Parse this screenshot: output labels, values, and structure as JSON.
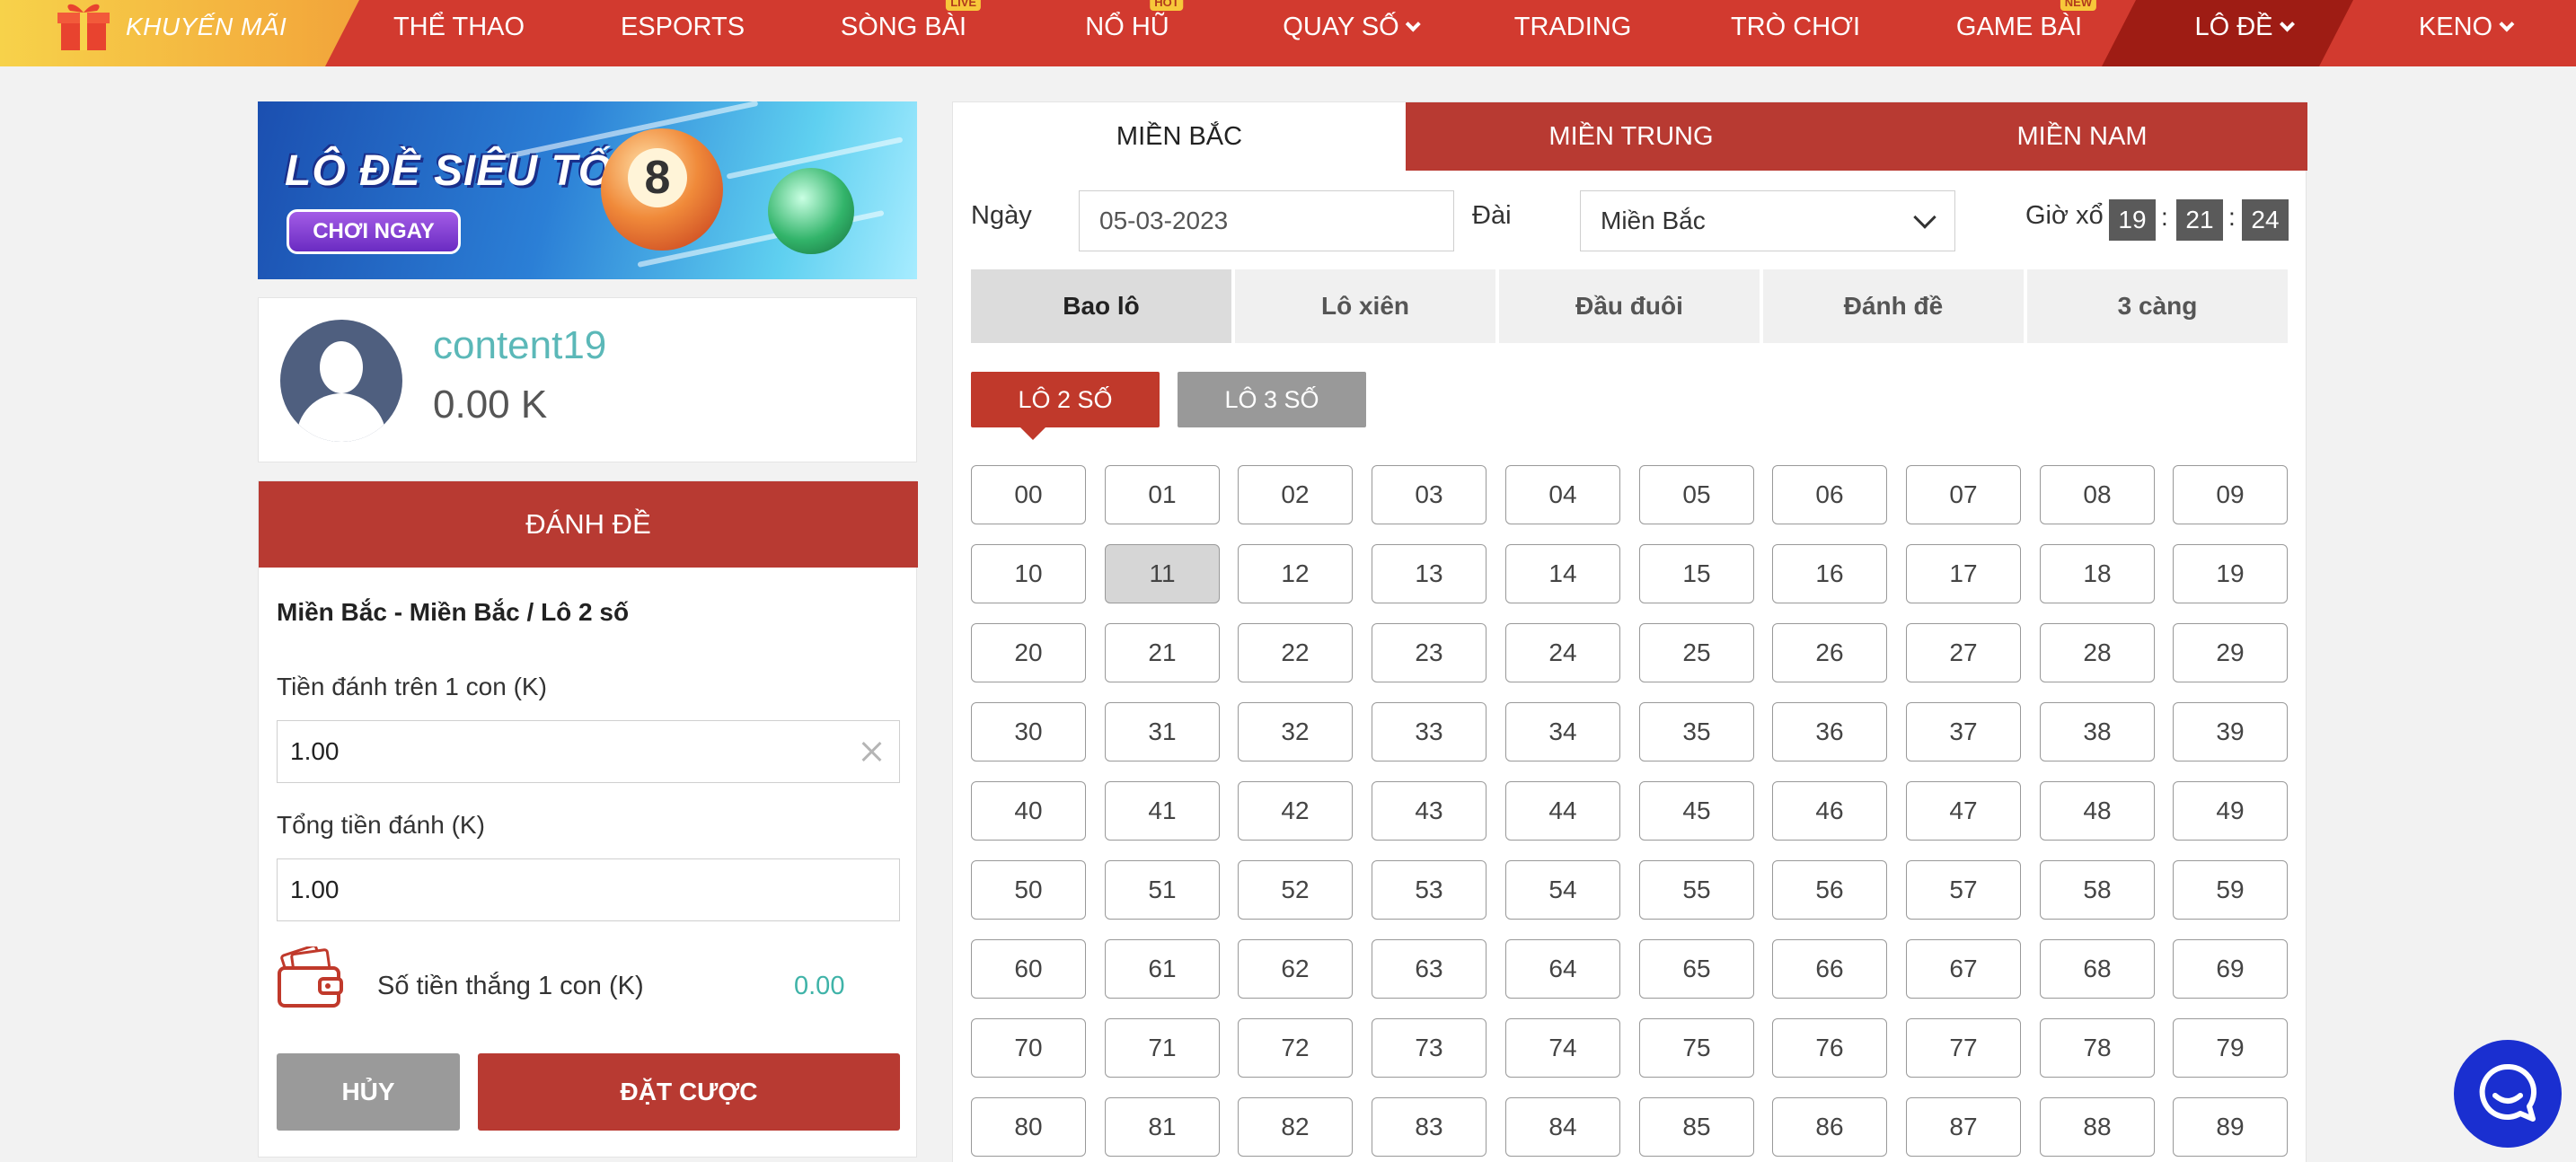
{
  "nav": {
    "promo_label": "KHUYẾN MÃI",
    "items": [
      {
        "label": "THỂ THAO",
        "badge": ""
      },
      {
        "label": "ESPORTS",
        "badge": ""
      },
      {
        "label": "SÒNG BÀI",
        "badge": "LIVE"
      },
      {
        "label": "NỔ HŨ",
        "badge": "HOT"
      },
      {
        "label": "QUAY SỐ",
        "badge": ""
      },
      {
        "label": "TRADING",
        "badge": ""
      },
      {
        "label": "TRÒ CHƠI",
        "badge": ""
      },
      {
        "label": "GAME BÀI",
        "badge": "NEW"
      },
      {
        "label": "LÔ ĐỀ",
        "badge": ""
      },
      {
        "label": "KENO",
        "badge": ""
      }
    ]
  },
  "banner": {
    "title": "LÔ ĐỀ SIÊU TỐC",
    "button": "CHƠI NGAY",
    "ball_number": "8"
  },
  "user": {
    "name": "content19",
    "balance": "0.00 K"
  },
  "bet_panel": {
    "header": "ĐÁNH ĐỀ",
    "subtitle": "Miền Bắc - Miền Bắc / Lô 2 số",
    "amount_label": "Tiền đánh trên 1 con (K)",
    "amount_value": "1.00",
    "total_label": "Tổng tiền đánh (K)",
    "total_value": "1.00",
    "win_label": "Số tiền thắng 1 con (K)",
    "win_value": "0.00",
    "cancel": "HỦY",
    "place_bet": "ĐẶT CƯỢC"
  },
  "regions": [
    "MIỀN BẮC",
    "MIỀN TRUNG",
    "MIỀN NAM"
  ],
  "filters": {
    "date_label": "Ngày",
    "date_value": "05-03-2023",
    "station_label": "Đài",
    "station_value": "Miền Bắc",
    "draw_label": "Giờ xổ",
    "draw_h": "19",
    "draw_m": "21",
    "draw_s": "24"
  },
  "bet_types": [
    "Bao lô",
    "Lô xiên",
    "Đầu đuôi",
    "Đánh đề",
    "3 càng"
  ],
  "sub_types": [
    "LÔ 2 SỐ",
    "LÔ 3 SỐ"
  ],
  "selected_number": "11",
  "numbers": [
    "00",
    "01",
    "02",
    "03",
    "04",
    "05",
    "06",
    "07",
    "08",
    "09",
    "10",
    "11",
    "12",
    "13",
    "14",
    "15",
    "16",
    "17",
    "18",
    "19",
    "20",
    "21",
    "22",
    "23",
    "24",
    "25",
    "26",
    "27",
    "28",
    "29",
    "30",
    "31",
    "32",
    "33",
    "34",
    "35",
    "36",
    "37",
    "38",
    "39",
    "40",
    "41",
    "42",
    "43",
    "44",
    "45",
    "46",
    "47",
    "48",
    "49",
    "50",
    "51",
    "52",
    "53",
    "54",
    "55",
    "56",
    "57",
    "58",
    "59",
    "60",
    "61",
    "62",
    "63",
    "64",
    "65",
    "66",
    "67",
    "68",
    "69",
    "70",
    "71",
    "72",
    "73",
    "74",
    "75",
    "76",
    "77",
    "78",
    "79",
    "80",
    "81",
    "82",
    "83",
    "84",
    "85",
    "86",
    "87",
    "88",
    "89"
  ],
  "colors": {
    "brand_red": "#d23a2f",
    "dark_red": "#b83a32",
    "teal": "#3fb3a8",
    "chat_blue": "#1a2fd0"
  }
}
